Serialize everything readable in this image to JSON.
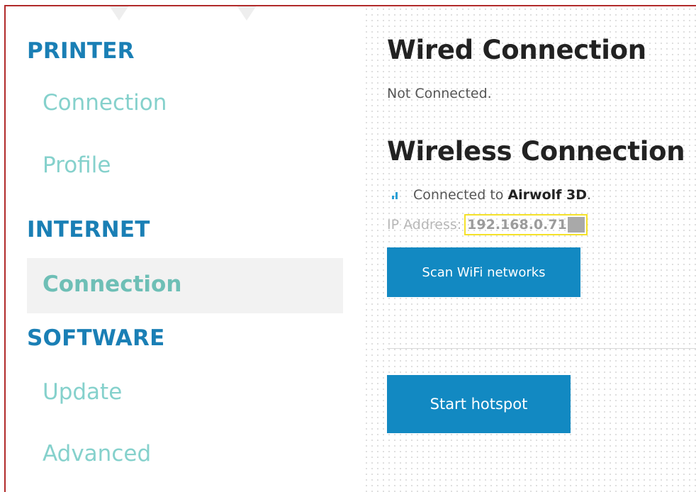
{
  "sidebar": {
    "sections": [
      {
        "heading": "PRINTER",
        "items": [
          "Connection",
          "Profile"
        ]
      },
      {
        "heading": "INTERNET",
        "items": [
          "Connection"
        ]
      },
      {
        "heading": "SOFTWARE",
        "items": [
          "Update",
          "Advanced"
        ]
      }
    ],
    "active_item": "INTERNET / Connection"
  },
  "main": {
    "wired": {
      "title": "Wired Connection",
      "status": "Not Connected."
    },
    "wireless": {
      "title": "Wireless Connection",
      "connected_prefix": "Connected to",
      "network_name": "Airwolf 3D",
      "connected_suffix": ".",
      "ip_label": "IP Address:",
      "ip_value": "192.168.0.71"
    },
    "scan_button": "Scan WiFi networks",
    "hotspot_button": "Start hotspot"
  },
  "colors": {
    "accent": "#1289c2",
    "heading": "#1a7fb5",
    "nav_text": "#85d1cc",
    "frame_border": "#b12a2a",
    "highlight": "#f4e12a"
  }
}
